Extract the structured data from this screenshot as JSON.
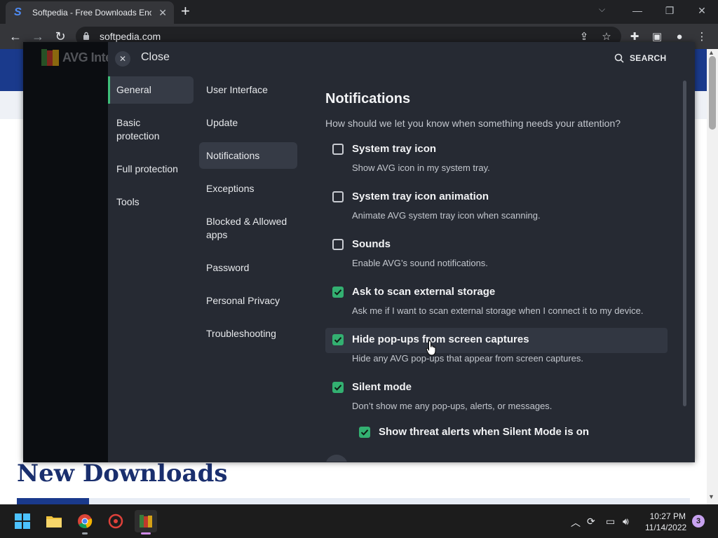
{
  "browser": {
    "tab_title": "Softpedia - Free Downloads Ency",
    "tab_favicon": "S",
    "url": "softpedia.com"
  },
  "page": {
    "heading": "New Downloads"
  },
  "avg": {
    "brand": "AVG Inte",
    "close_label": "Close",
    "search_label": "SEARCH",
    "categories": [
      {
        "label": "General",
        "active": true
      },
      {
        "label": "Basic protection",
        "active": false
      },
      {
        "label": "Full protection",
        "active": false
      },
      {
        "label": "Tools",
        "active": false
      }
    ],
    "subcategories": [
      {
        "label": "User Interface",
        "active": false
      },
      {
        "label": "Update",
        "active": false
      },
      {
        "label": "Notifications",
        "active": true
      },
      {
        "label": "Exceptions",
        "active": false
      },
      {
        "label": "Blocked & Allowed apps",
        "active": false
      },
      {
        "label": "Password",
        "active": false
      },
      {
        "label": "Personal Privacy",
        "active": false
      },
      {
        "label": "Troubleshooting",
        "active": false
      }
    ],
    "content": {
      "title": "Notifications",
      "subtitle": "How should we let you know when something needs your attention?",
      "options": [
        {
          "label": "System tray icon",
          "description": "Show AVG icon in my system tray.",
          "checked": false
        },
        {
          "label": "System tray icon animation",
          "description": "Animate AVG system tray icon when scanning.",
          "checked": false
        },
        {
          "label": "Sounds",
          "description": "Enable AVG’s sound notifications.",
          "checked": false
        },
        {
          "label": "Ask to scan external storage",
          "description": "Ask me if I want to scan external storage when I connect it to my device.",
          "checked": true
        },
        {
          "label": "Hide pop-ups from screen captures",
          "description": "Hide any AVG pop-ups that appear from screen captures.",
          "checked": true
        },
        {
          "label": "Silent mode",
          "description": "Don’t show me any pop-ups, alerts, or messages.",
          "checked": true
        }
      ],
      "suboption": {
        "label": "Show threat alerts when Silent Mode is on",
        "checked": true
      }
    }
  },
  "taskbar": {
    "time": "10:27 PM",
    "date": "11/14/2022",
    "notifications": "3"
  },
  "colors": {
    "accent_green": "#33b071",
    "panel": "#262a33",
    "site_blue": "#1a3a8c"
  }
}
